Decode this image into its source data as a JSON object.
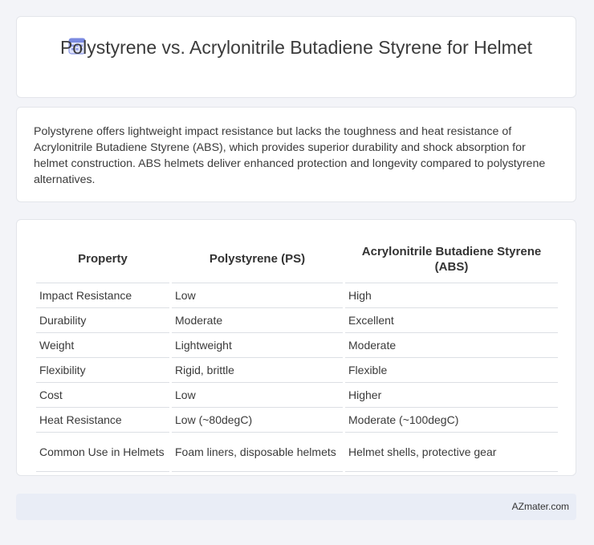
{
  "header": {
    "title": "Polystyrene vs. Acrylonitrile Butadiene Styrene for Helmet",
    "icon": "calendar-icon",
    "accent": "#7b8be0"
  },
  "summary": "Polystyrene offers lightweight impact resistance but lacks the toughness and heat resistance of Acrylonitrile Butadiene Styrene (ABS), which provides superior durability and shock absorption for helmet construction. ABS helmets deliver enhanced protection and longevity compared to polystyrene alternatives.",
  "table": {
    "headers": [
      "Property",
      "Polystyrene (PS)",
      "Acrylonitrile Butadiene Styrene (ABS)"
    ],
    "rows": [
      [
        "Impact Resistance",
        "Low",
        "High"
      ],
      [
        "Durability",
        "Moderate",
        "Excellent"
      ],
      [
        "Weight",
        "Lightweight",
        "Moderate"
      ],
      [
        "Flexibility",
        "Rigid, brittle",
        "Flexible"
      ],
      [
        "Cost",
        "Low",
        "Higher"
      ],
      [
        "Heat Resistance",
        "Low (~80degC)",
        "Moderate (~100degC)"
      ],
      [
        "Common Use in Helmets",
        "Foam liners, disposable helmets",
        "Helmet shells, protective gear"
      ]
    ]
  },
  "footer": {
    "brand": "AZmater.com"
  }
}
